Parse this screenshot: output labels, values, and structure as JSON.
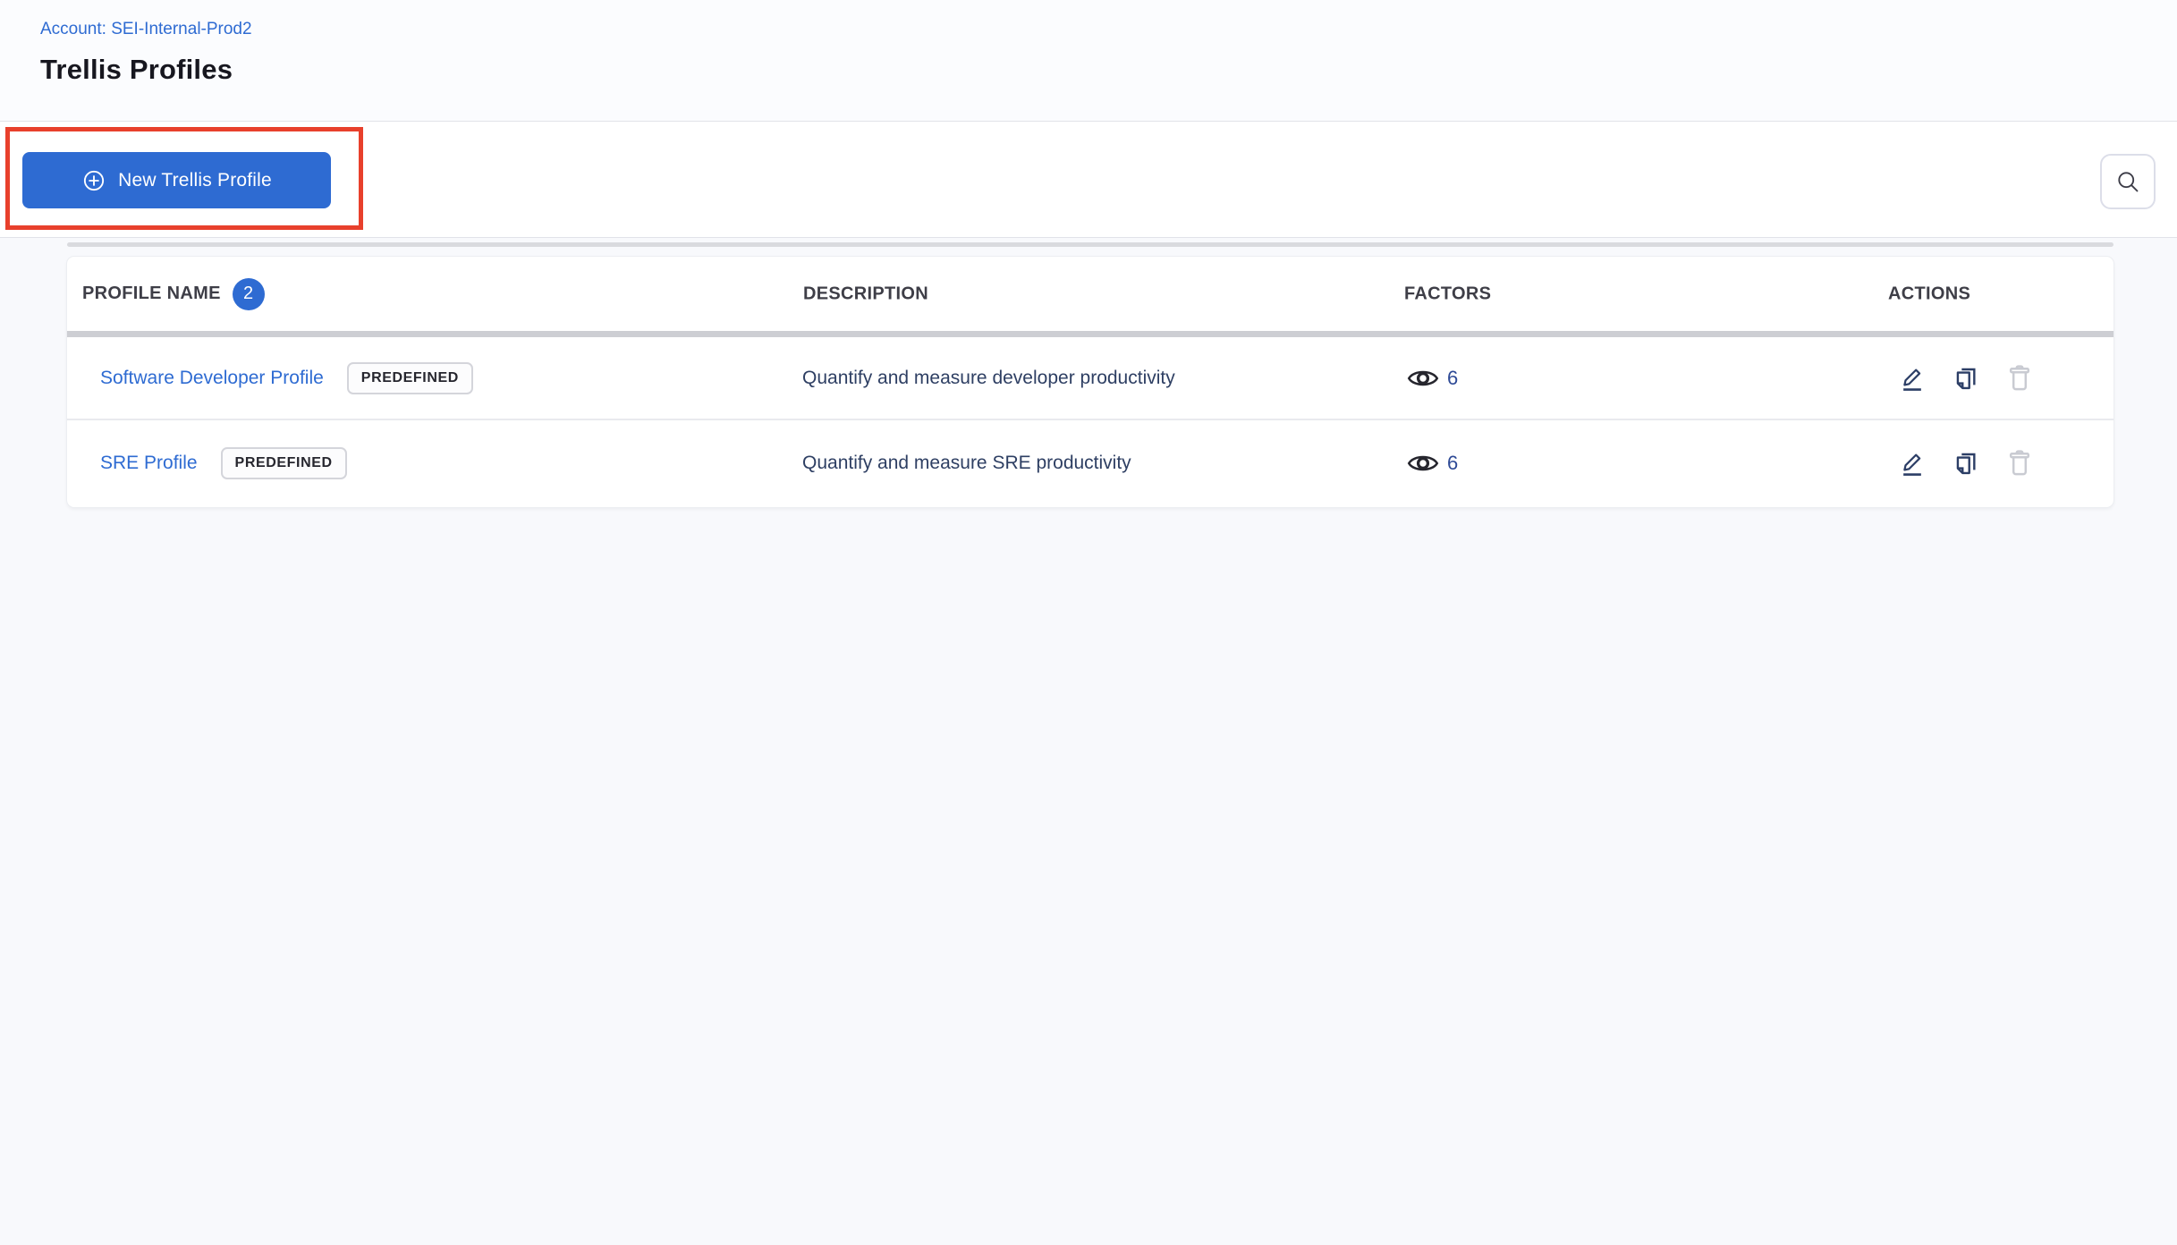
{
  "header": {
    "account_breadcrumb": "Account: SEI-Internal-Prod2",
    "page_title": "Trellis Profiles"
  },
  "toolbar": {
    "new_profile_button_label": "New Trellis Profile"
  },
  "table": {
    "headers": {
      "profile_name": "PROFILE NAME",
      "description": "DESCRIPTION",
      "factors": "FACTORS",
      "actions": "ACTIONS"
    },
    "profile_count": "2",
    "rows": [
      {
        "name": "Software Developer Profile",
        "tag": "PREDEFINED",
        "description": "Quantify and measure developer productivity",
        "factors_count": "6"
      },
      {
        "name": "SRE Profile",
        "tag": "PREDEFINED",
        "description": "Quantify and measure SRE productivity",
        "factors_count": "6"
      }
    ]
  },
  "icons": {
    "new_profile": "circled-plus-icon",
    "search": "magnifier-icon",
    "factors": "eye-icon",
    "edit": "pencil-icon",
    "clone": "duplicate-pages-icon",
    "delete": "trash-icon"
  },
  "colors": {
    "primary_blue": "#2e6bd2",
    "link_blue": "#2e6bd2",
    "annotation_red": "#e8402c",
    "action_icon_navy": "#2c3e66",
    "disabled_icon_gray": "#c9cbd2",
    "description_text": "#2e3f63",
    "factors_count_text": "#2e4a96"
  },
  "annotation": {
    "type": "red-highlight-box-around-new-profile-button"
  }
}
